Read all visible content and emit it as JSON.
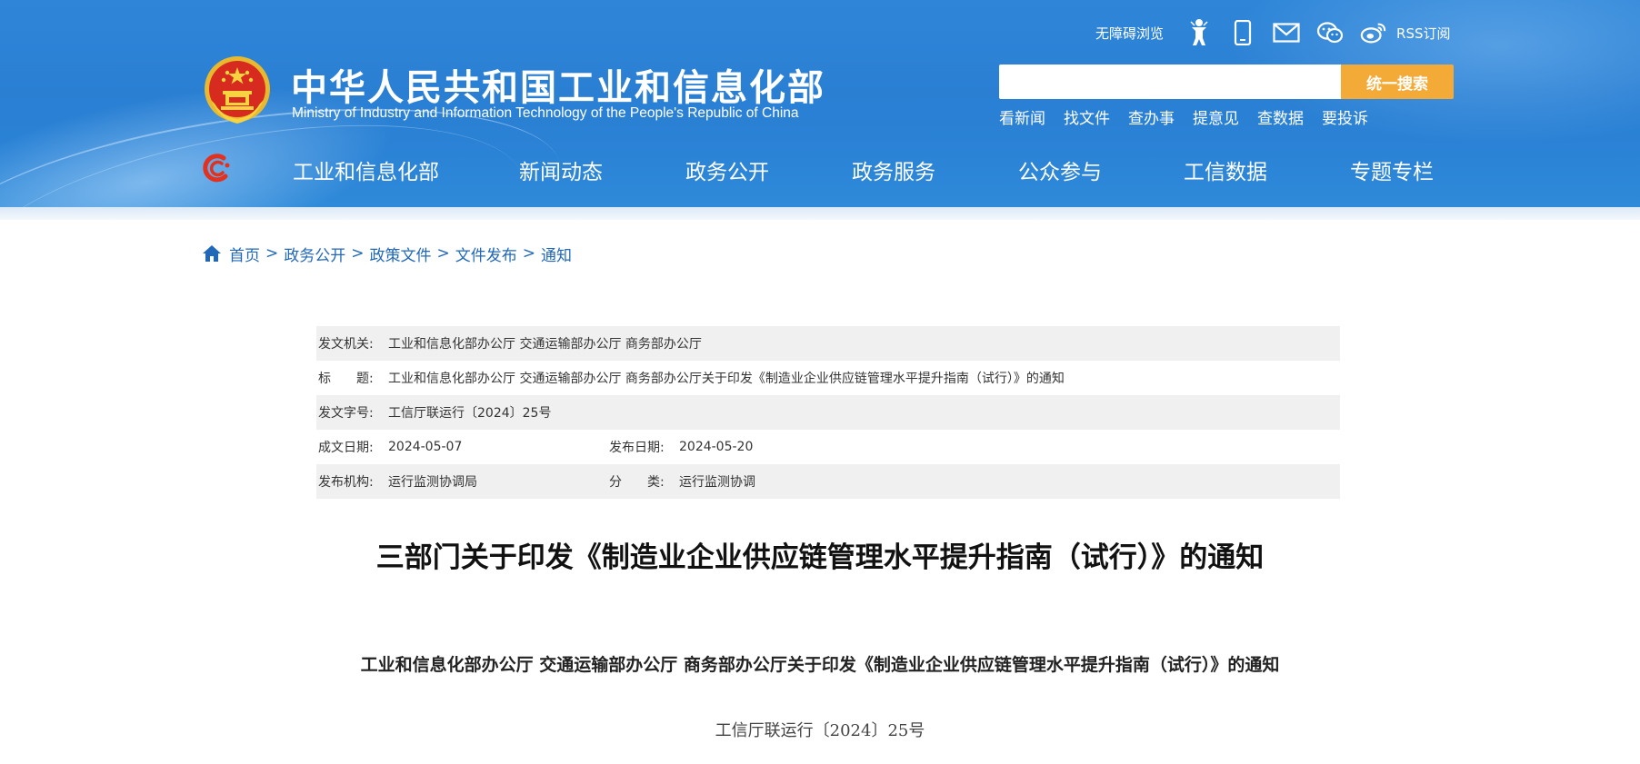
{
  "header": {
    "title": "中华人民共和国工业和信息化部",
    "subtitle": "Ministry of Industry and Information Technology of the People's Republic of China",
    "emblem_icon": "national-emblem-icon",
    "top_links": {
      "accessibility": "无障碍浏览",
      "rss": "RSS订阅",
      "icons": [
        "accessibility-person-icon",
        "mobile-phone-icon",
        "mail-icon",
        "wechat-icon",
        "weibo-icon"
      ]
    },
    "search": {
      "placeholder": "",
      "button_label": "统一搜索"
    },
    "quick_links": [
      "看新闻",
      "找文件",
      "查办事",
      "提意见",
      "查数据",
      "要投诉"
    ],
    "nav": [
      "工业和信息化部",
      "新闻动态",
      "政务公开",
      "政务服务",
      "公众参与",
      "工信数据",
      "专题专栏"
    ],
    "colors": {
      "header_blue": "#2b83d6",
      "search_button": "#f3aa36",
      "link_blue": "#2168b8"
    }
  },
  "breadcrumb": [
    "首页",
    "政务公开",
    "政策文件",
    "文件发布",
    "通知"
  ],
  "meta": {
    "issuer_label": "发文机关:",
    "issuer_value": "工业和信息化部办公厅 交通运输部办公厅 商务部办公厅",
    "title_label": "标　　题:",
    "title_value": "工业和信息化部办公厅 交通运输部办公厅 商务部办公厅关于印发《制造业企业供应链管理水平提升指南（试行）》的通知",
    "docno_label": "发文字号:",
    "docno_value": "工信厅联运行〔2024〕25号",
    "written_label": "成文日期:",
    "written_value": "2024-05-07",
    "published_label": "发布日期:",
    "published_value": "2024-05-20",
    "agency_label": "发布机构:",
    "agency_value": "运行监测协调局",
    "category_label": "分　　类:",
    "category_value": "运行监测协调"
  },
  "document": {
    "title": "三部门关于印发《制造业企业供应链管理水平提升指南（试行）》的通知",
    "subtitle": "工业和信息化部办公厅 交通运输部办公厅 商务部办公厅关于印发《制造业企业供应链管理水平提升指南（试行）》的通知",
    "number": "工信厅联运行〔2024〕25号"
  }
}
